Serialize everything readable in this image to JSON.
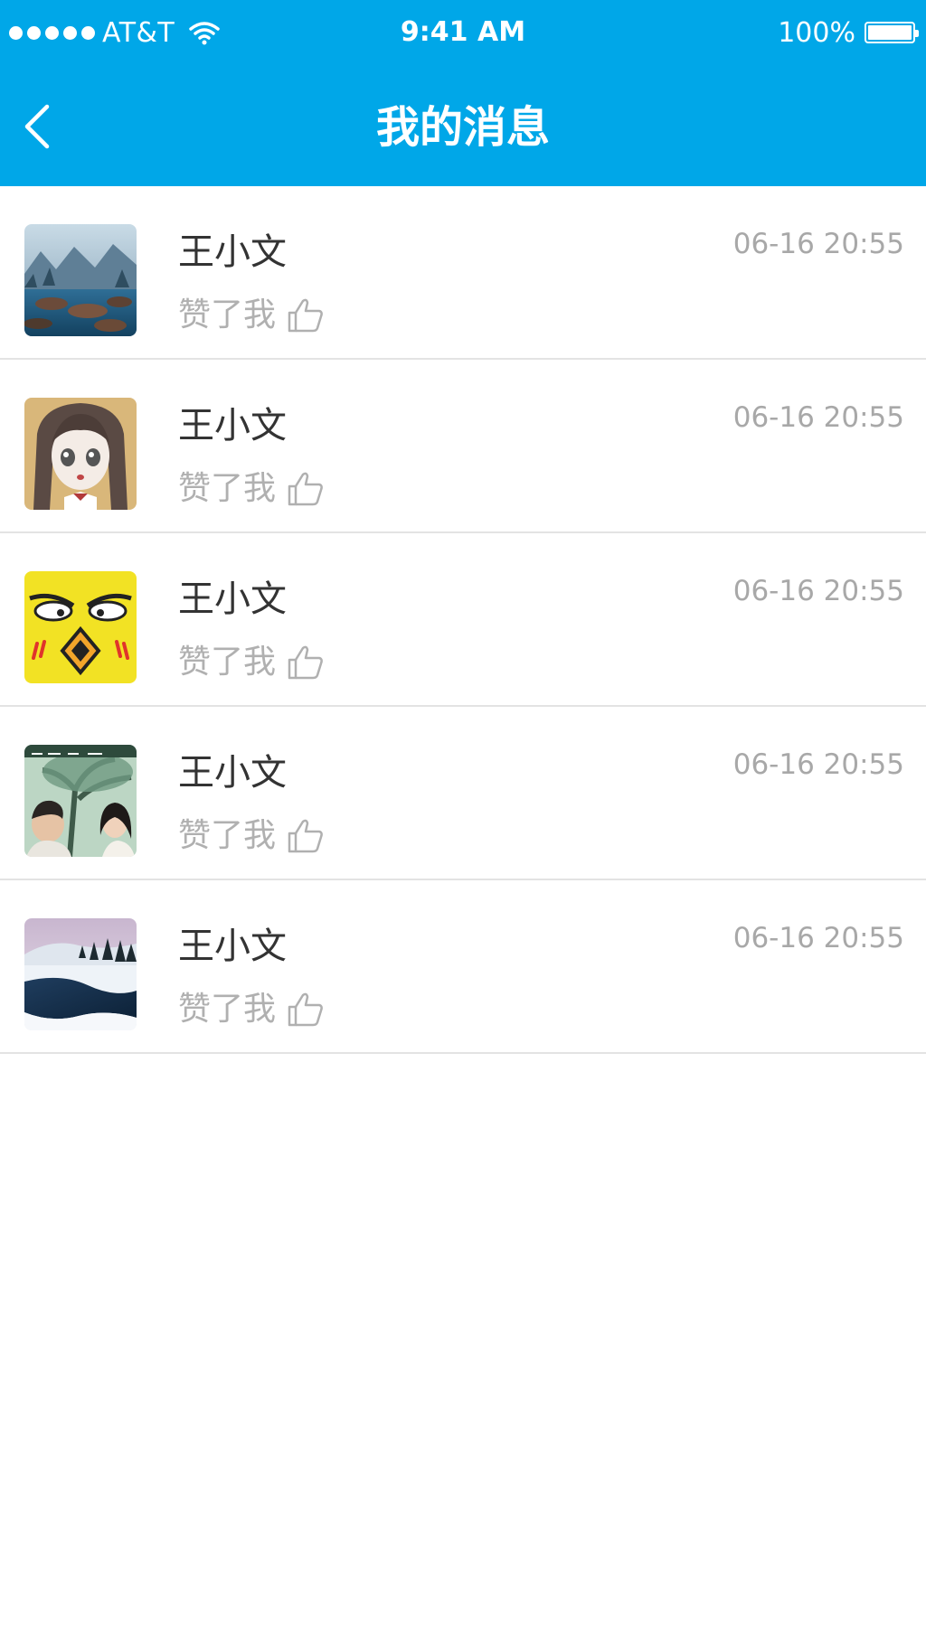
{
  "status_bar": {
    "carrier": "AT&T",
    "time": "9:41 AM",
    "battery": "100%"
  },
  "nav": {
    "title": "我的消息",
    "back_icon": "chevron-left-icon"
  },
  "colors": {
    "header_bg": "#00a7e8",
    "name_text": "#333333",
    "secondary_text": "#b0b0b0",
    "divider": "#e3e3e3"
  },
  "messages": [
    {
      "name": "王小文",
      "action": "赞了我",
      "time": "06-16 20:55",
      "avatar": "mountain-lake-avatar"
    },
    {
      "name": "王小文",
      "action": "赞了我",
      "time": "06-16 20:55",
      "avatar": "anime-girl-avatar"
    },
    {
      "name": "王小文",
      "action": "赞了我",
      "time": "06-16 20:55",
      "avatar": "yellow-bird-avatar"
    },
    {
      "name": "王小文",
      "action": "赞了我",
      "time": "06-16 20:55",
      "avatar": "couple-photo-avatar"
    },
    {
      "name": "王小文",
      "action": "赞了我",
      "time": "06-16 20:55",
      "avatar": "snowy-river-avatar"
    }
  ]
}
